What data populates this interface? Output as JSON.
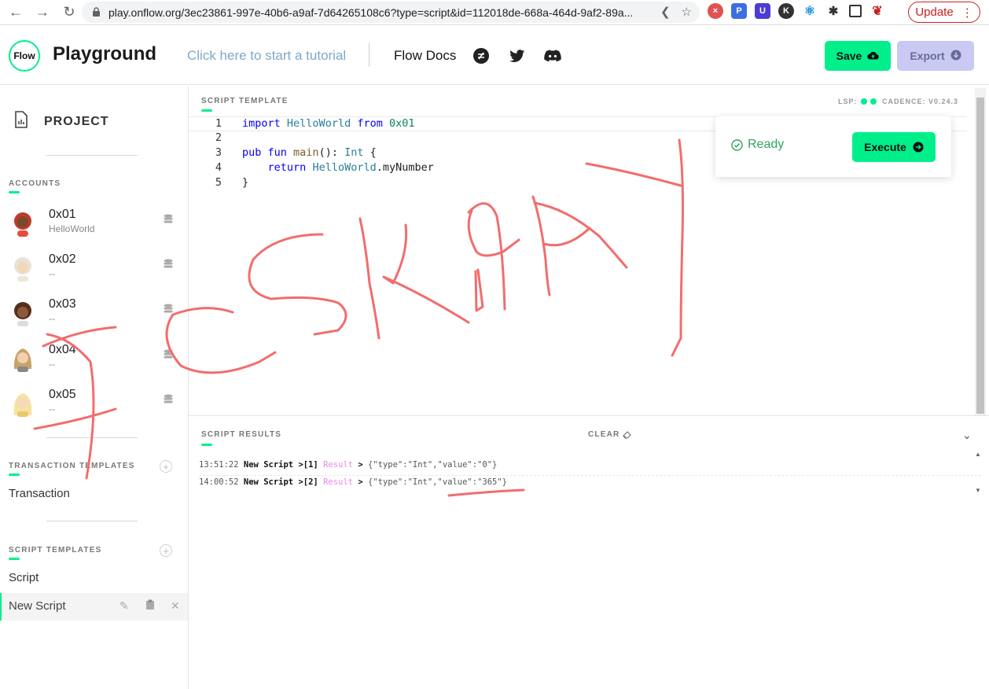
{
  "browser": {
    "url": "play.onflow.org/3ec23861-997e-40b6-a9af-7d64265108c6?type=script&id=112018de-668a-464d-9af2-89a...",
    "update_label": "Update"
  },
  "header": {
    "logo_text": "Flow",
    "title": "Playground",
    "tutorial_link": "Click here to start a tutorial",
    "docs_link": "Flow Docs",
    "save_label": "Save",
    "export_label": "Export"
  },
  "sidebar": {
    "project_label": "PROJECT",
    "accounts_heading": "ACCOUNTS",
    "accounts": [
      {
        "address": "0x01",
        "contract": "HelloWorld"
      },
      {
        "address": "0x02",
        "contract": "--"
      },
      {
        "address": "0x03",
        "contract": "--"
      },
      {
        "address": "0x04",
        "contract": "--"
      },
      {
        "address": "0x05",
        "contract": "--"
      }
    ],
    "transaction_templates_heading": "TRANSACTION TEMPLATES",
    "transaction_templates": [
      "Transaction"
    ],
    "script_templates_heading": "SCRIPT TEMPLATES",
    "script_templates": [
      "Script"
    ],
    "active_script": "New Script"
  },
  "editor": {
    "heading": "SCRIPT TEMPLATE",
    "lsp_label": "LSP:",
    "cadence_version": "CADENCE: V0.24.3",
    "line_numbers": [
      "1",
      "2",
      "3",
      "4",
      "5"
    ],
    "code": {
      "l1_kw1": "import",
      "l1_ty": "HelloWorld",
      "l1_kw2": "from",
      "l1_addr": "0x01",
      "l3_kw": "pub fun",
      "l3_fn": "main",
      "l3_mid": "():",
      "l3_ty": "Int",
      "l3_end": "{",
      "l4_kw": "return",
      "l4_ty": "HelloWorld",
      "l4_rest": ".myNumber",
      "l5": "}"
    }
  },
  "run_card": {
    "status": "Ready",
    "execute_label": "Execute"
  },
  "results": {
    "heading": "SCRIPT RESULTS",
    "clear_label": "CLEAR",
    "lines": [
      {
        "time": "13:51:22",
        "name": "New Script",
        "index": "[1]",
        "type": "Result",
        "value": "{\"type\":\"Int\",\"value\":\"0\"}"
      },
      {
        "time": "14:00:52",
        "name": "New Script",
        "index": "[2]",
        "type": "Result",
        "value": "{\"type\":\"Int\",\"value\":\"365\"}"
      }
    ]
  },
  "colors": {
    "accent": "#00ef8b",
    "export_bg": "#c9c9f3",
    "scribble": "#f26d6d"
  }
}
